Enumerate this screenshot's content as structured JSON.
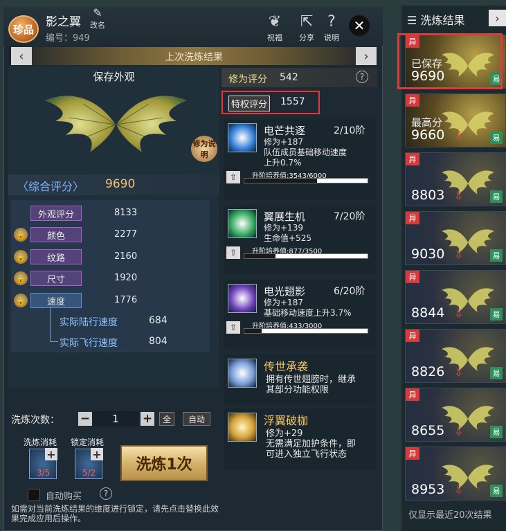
{
  "header": {
    "rarity_badge": "珍品",
    "item_name": "影之翼",
    "rename_label": "改名",
    "id_prefix": "编号：",
    "id_value": "949",
    "buttons": [
      {
        "icon": "blessing-icon",
        "label": "祝福"
      },
      {
        "icon": "share-icon",
        "label": "分享"
      },
      {
        "icon": "help-icon",
        "label": "说明"
      }
    ]
  },
  "banner": {
    "title": "上次洗炼结果"
  },
  "appearance": {
    "title": "保存外观",
    "repair_tag": "修为说明",
    "score_label": "〈综合评分〉",
    "score_value": "9690"
  },
  "attributes": [
    {
      "label": "外观评分",
      "value": "8133",
      "locked": false,
      "color": "#b05ad6"
    },
    {
      "label": "颜色",
      "value": "2277",
      "locked": true,
      "color": "#b05ad6"
    },
    {
      "label": "纹路",
      "value": "2160",
      "locked": true,
      "color": "#b05ad6"
    },
    {
      "label": "尺寸",
      "value": "1920",
      "locked": true,
      "color": "#b05ad6"
    },
    {
      "label": "速度",
      "value": "1776",
      "locked": true,
      "color": "#5a8fd6"
    }
  ],
  "sub_attributes": [
    {
      "label": "实际陆行速度",
      "value": "684"
    },
    {
      "label": "实际飞行速度",
      "value": "804"
    }
  ],
  "refine": {
    "count_label": "洗炼次数：",
    "count_value": "1",
    "all_label": "全",
    "auto_label": "自动",
    "cost_label": "洗炼消耗",
    "lock_cost_label": "锁定消耗",
    "cost_qty": "3/5",
    "lock_qty": "5/2",
    "button_label": "洗炼1次",
    "auto_buy_label": "自动购买",
    "notice": "如需对当前洗炼结果的维度进行锁定，请先点击替换此效果完成应用后操作。"
  },
  "ratings": {
    "cultivation_label": "修为评分",
    "cultivation_value": "542",
    "privilege_label": "特权评分",
    "privilege_value": "1557"
  },
  "skills": [
    {
      "name": "电芒共逐",
      "stage": "2/10阶",
      "desc": [
        "修为+187",
        "队伍成员基础移动速度",
        "上升0.7%"
      ],
      "upg_label": "升阶培养值:3543/6000",
      "progress": 0.59
    },
    {
      "name": "翼展生机",
      "stage": "7/20阶",
      "desc": [
        "修为+139",
        "生命值+525"
      ],
      "upg_label": "升阶培养值:877/3500",
      "progress": 0.25
    },
    {
      "name": "电光翅影",
      "stage": "6/20阶",
      "desc": [
        "修为+187",
        "基础移动速度上升3.7%"
      ],
      "upg_label": "升阶培养值:433/3000",
      "progress": 0.14
    }
  ],
  "special_skills": [
    {
      "name": "传世承袭",
      "desc": [
        "拥有传世翅膀时，继承",
        "其部分功能权限"
      ]
    },
    {
      "name": "浮翼破枷",
      "desc": [
        "修为+29",
        "无需满足加护条件，即",
        "可进入独立飞行状态"
      ]
    }
  ],
  "history": {
    "title": "洗炼结果",
    "foot": "仅显示最近20次结果",
    "corner_label": "异",
    "easy_label": "易",
    "down_arrow": "⇩",
    "cards": [
      {
        "label": "已保存",
        "value": "9690",
        "down": false
      },
      {
        "label": "最高分",
        "value": "9660",
        "down": true
      },
      {
        "label": "",
        "value": "8803",
        "down": true
      },
      {
        "label": "",
        "value": "9030",
        "down": true
      },
      {
        "label": "",
        "value": "8844",
        "down": true
      },
      {
        "label": "",
        "value": "8826",
        "down": true
      },
      {
        "label": "",
        "value": "8655",
        "down": true
      },
      {
        "label": "",
        "value": "8953",
        "down": true
      }
    ]
  }
}
